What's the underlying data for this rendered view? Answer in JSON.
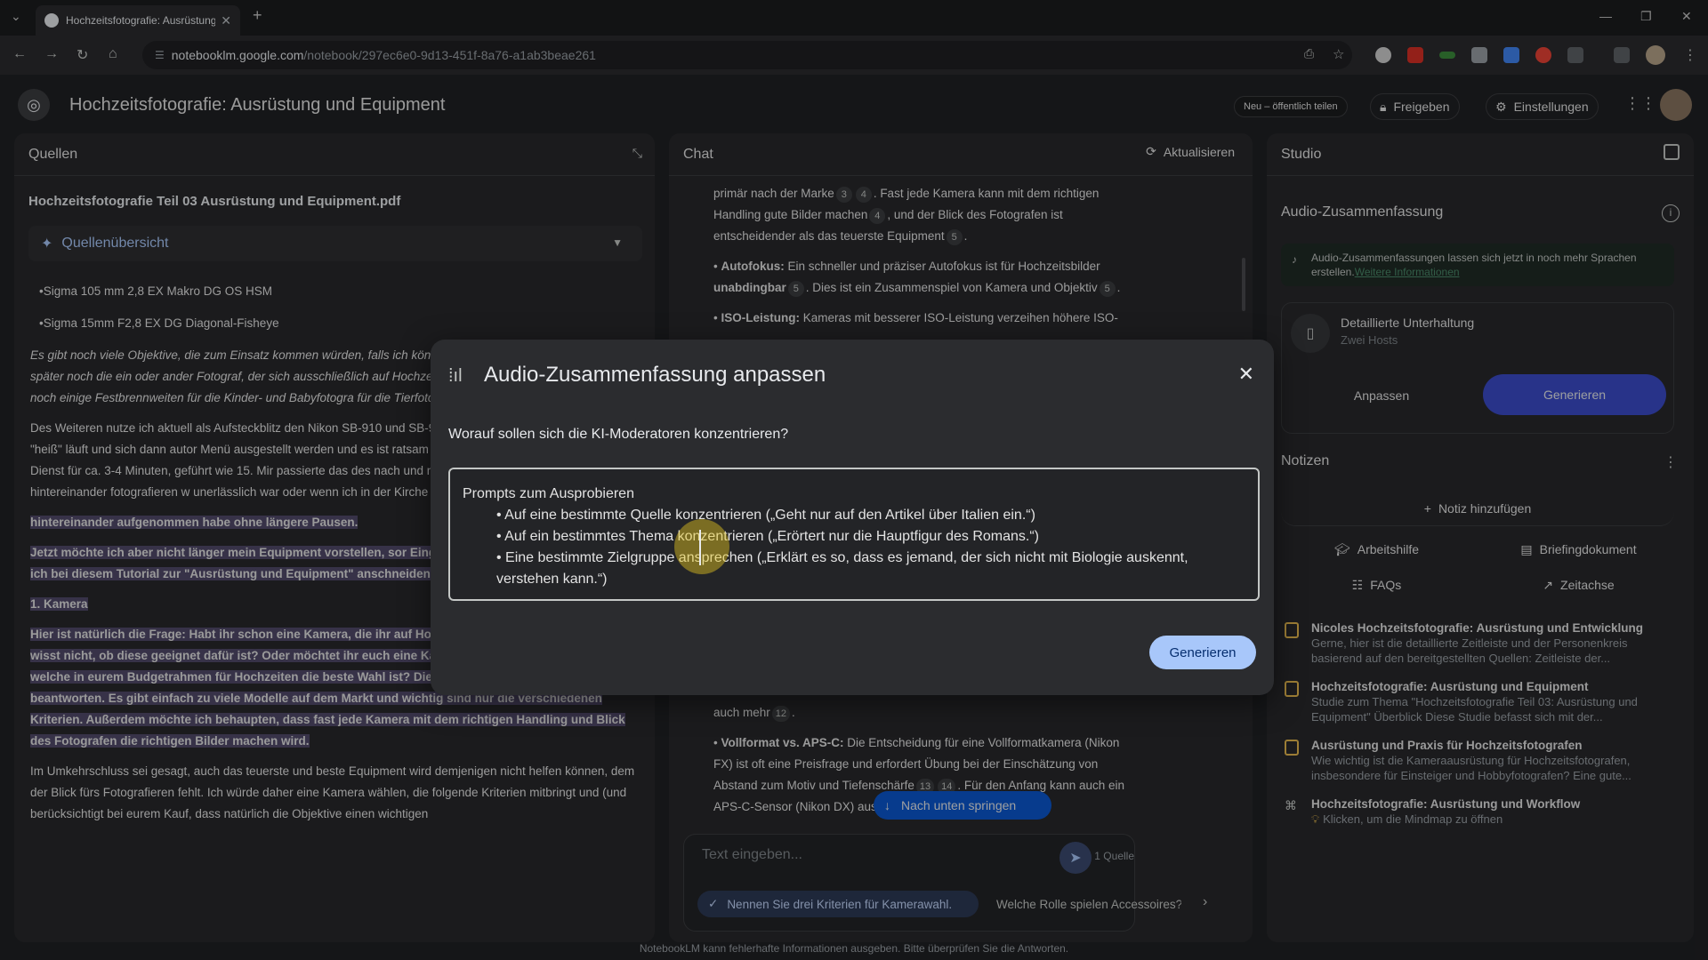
{
  "browser": {
    "tab_title": "Hochzeitsfotografie: Ausrüstung",
    "url_host": "notebooklm.google.com",
    "url_path": "/notebook/297ec6e0-9d13-451f-8a76-a1ab3beae261"
  },
  "header": {
    "title": "Hochzeitsfotografie: Ausrüstung und Equipment",
    "share_public": "Neu – öffentlich teilen",
    "share": "Freigeben",
    "settings": "Einstellungen"
  },
  "sources": {
    "title": "Quellen",
    "doc_title": "Hochzeitsfotografie Teil 03 Ausrüstung und Equipment.pdf",
    "overview": "Quellenübersicht",
    "bullets": [
      "•Sigma 105 mm 2,8 EX Makro DG OS HSM",
      "•Sigma 15mm F2,8 EX DG Diagonal-Fisheye"
    ],
    "para1": "Es gibt noch viele Objektive, die zum Einsatz kommen würden, falls ich können! Dazu gebe ich unter Objektive später noch die ein oder ander Fotograf, der sich ausschließlich auf Hochzeiten spezialisiert hat, muss habe ich noch einige Festbrennweiten für die Kinder- und Babyfotogra für die Tierfotografie.",
    "para2": "Des Weiteren nutze ich aktuell als Aufsteckblitz den Nikon SB-910 und SB-900 ist zu berücksichtigen, dass er \"heiß\" läuft und sich dann autor Menü ausgestellt werden und es ist ratsam dies vor einer Hochzeit zu n seinen Dienst für ca. 3-4 Minuten, geführt wie 15. Mir passierte das des nach und nach 120 Gäste auf einer Feier hintereinander fotografieren w unerlässlich war oder wenn ich in der Kirche bei Hochzeit oder Taufe vi",
    "hl1": "hintereinander aufgenommen habe ohne längere Pausen.",
    "hl2": "Jetzt möchte ich aber nicht länger mein Equipment vorstellen, sor Eingemachte. Folgende Punkte möchte ich bei diesem Tutorial zur \"Ausrüstung und Equipment\" anschneiden:",
    "hl3": "1. Kamera",
    "hl4": "Hier ist natürlich die Frage: Habt ihr schon eine Kamera, die ihr auf Hochzeiten einsetzen möchtet, und wisst nicht, ob diese geeignet dafür ist? Oder möchtet ihr euch eine Kamera kaufen und wollt wissen, welche in eurem Budgetrahmen für Hochzeiten die beste Wahl ist? Diese Frage ist nicht so einfach zu beantworten. Es gibt einfach zu viele Modelle auf dem Markt und wichtig sind nur die verschiedenen Kriterien. Außerdem möchte ich behaupten, dass fast jede Kamera mit dem richtigen Handling und Blick des Fotografen die richtigen Bilder machen wird.",
    "para3": "Im Umkehrschluss sei gesagt, auch das teuerste und beste Equipment wird demjenigen nicht helfen können, dem der Blick fürs Fotografieren fehlt. Ich würde daher eine Kamera wählen, die folgende Kriterien mitbringt und (und berücksichtigt bei eurem Kauf, dass natürlich die Objektive einen wichtigen"
  },
  "chat": {
    "title": "Chat",
    "refresh": "Aktualisieren",
    "m1a": "primär nach der Marke",
    "m1b": ". Fast jede Kamera kann mit dem richtigen Handling gute Bilder machen",
    "m1c": ", und der Blick des Fotografen ist entscheidender als das teuerste Equipment",
    "m2k": "Autofokus:",
    "m2a": " Ein schneller und präziser Autofokus ist für Hochzeitsbilder ",
    "m2b": "unabdingbar",
    "m2c": ". Dies ist ein Zusammenspiel von Kamera und Objektiv",
    "m3k": "ISO-Leistung:",
    "m3a": " Kameras mit besserer ISO-Leistung verzeihen höhere ISO-",
    "m4": "auch mehr",
    "m5k": "Vollformat vs. APS-C:",
    "m5a": " Die Entscheidung für eine Vollformatkamera (Nikon FX) ist oft eine Preisfrage und erfordert Übung bei der Einschätzung von Abstand zum Motiv und Tiefenschärfe",
    "m5b": ". Für den Anfang kann auch ein APS-C-Sensor (Nikon DX) ausreicl",
    "cites": [
      "3",
      "4",
      "4",
      "5",
      "5",
      "5",
      "12",
      "13",
      "14"
    ],
    "jump": "Nach unten springen",
    "placeholder": "Text eingeben...",
    "source_count": "1 Quelle",
    "sug1": "Nennen Sie drei Kriterien für Kamerawahl.",
    "sug2": "Welche Rolle spielen Accessoires?"
  },
  "studio": {
    "title": "Studio",
    "audio_title": "Audio-Zusammenfassung",
    "info": "Audio-Zusammenfassungen lassen sich jetzt in noch mehr Sprachen erstellen.",
    "info_link": "Weitere Informationen",
    "card_title": "Detaillierte Unterhaltung",
    "card_sub": "Zwei Hosts",
    "customize": "Anpassen",
    "generate": "Generieren",
    "notes_title": "Notizen",
    "add_note": "Notiz hinzufügen",
    "btn_guide": "Arbeitshilfe",
    "btn_brief": "Briefingdokument",
    "btn_faq": "FAQs",
    "btn_timeline": "Zeitachse",
    "notes": [
      {
        "title": "Nicoles Hochzeitsfotografie: Ausrüstung und Entwicklung",
        "preview": "Gerne, hier ist die detaillierte Zeitleiste und der Personenkreis basierend auf den bereitgestellten Quellen: Zeitleiste der..."
      },
      {
        "title": "Hochzeitsfotografie: Ausrüstung und Equipment",
        "preview": "Studie zum Thema \"Hochzeitsfotografie Teil 03: Ausrüstung und Equipment\" Überblick Diese Studie befasst sich mit der..."
      },
      {
        "title": "Ausrüstung und Praxis für Hochzeitsfotografen",
        "preview": "Wie wichtig ist die Kameraausrüstung für Hochzeitsfotografen, insbesondere für Einsteiger und Hobbyfotografen? Eine gute..."
      },
      {
        "title": "Hochzeitsfotografie: Ausrüstung und Workflow",
        "preview": "Klicken, um die Mindmap zu öffnen"
      }
    ]
  },
  "dialog": {
    "title": "Audio-Zusammenfassung anpassen",
    "question": "Worauf sollen sich die KI-Moderatoren konzentrieren?",
    "prompt_head": "Prompts zum Ausprobieren",
    "p1": "• Auf eine bestimmte Quelle konzentrieren („Geht nur auf den Artikel über Italien ein.“)",
    "p2": "• Auf ein bestimmtes Thema konzentrieren („Erörtert nur die Hauptfigur des Romans.“)",
    "p3": "• Eine bestimmte Zielgruppe ansprechen („Erklärt es so, dass es jemand, der sich nicht mit Biologie auskennt, verstehen kann.“)",
    "generate": "Generieren"
  },
  "footer": "NotebookLM kann fehlerhafte Informationen ausgeben. Bitte überprüfen Sie die Antworten.",
  "colors": {
    "accent": "#0b57d0",
    "highlight": "#514a6b",
    "generate_light": "#a8c7fa"
  }
}
